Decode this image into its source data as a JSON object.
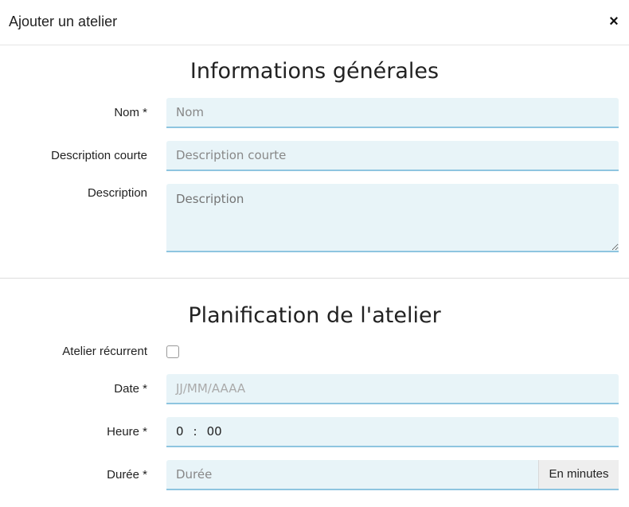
{
  "modal": {
    "title": "Ajouter un atelier",
    "close_glyph": "×"
  },
  "sections": {
    "general": "Informations générales",
    "planning": "Planification de l'atelier"
  },
  "fields": {
    "nom": {
      "label": "Nom *",
      "placeholder": "Nom"
    },
    "short_desc": {
      "label": "Description courte",
      "placeholder": "Description courte"
    },
    "description": {
      "label": "Description",
      "placeholder": "Description"
    },
    "recurrent": {
      "label": "Atelier récurrent"
    },
    "date": {
      "label": "Date *",
      "placeholder": "JJ/MM/AAAA"
    },
    "heure": {
      "label": "Heure *",
      "hours": "0",
      "separator": ":",
      "minutes": "00"
    },
    "duree": {
      "label": "Durée *",
      "placeholder": "Durée",
      "addon": "En minutes"
    }
  },
  "icons": {
    "close": "close-icon",
    "resize": "resize-handle-icon"
  }
}
